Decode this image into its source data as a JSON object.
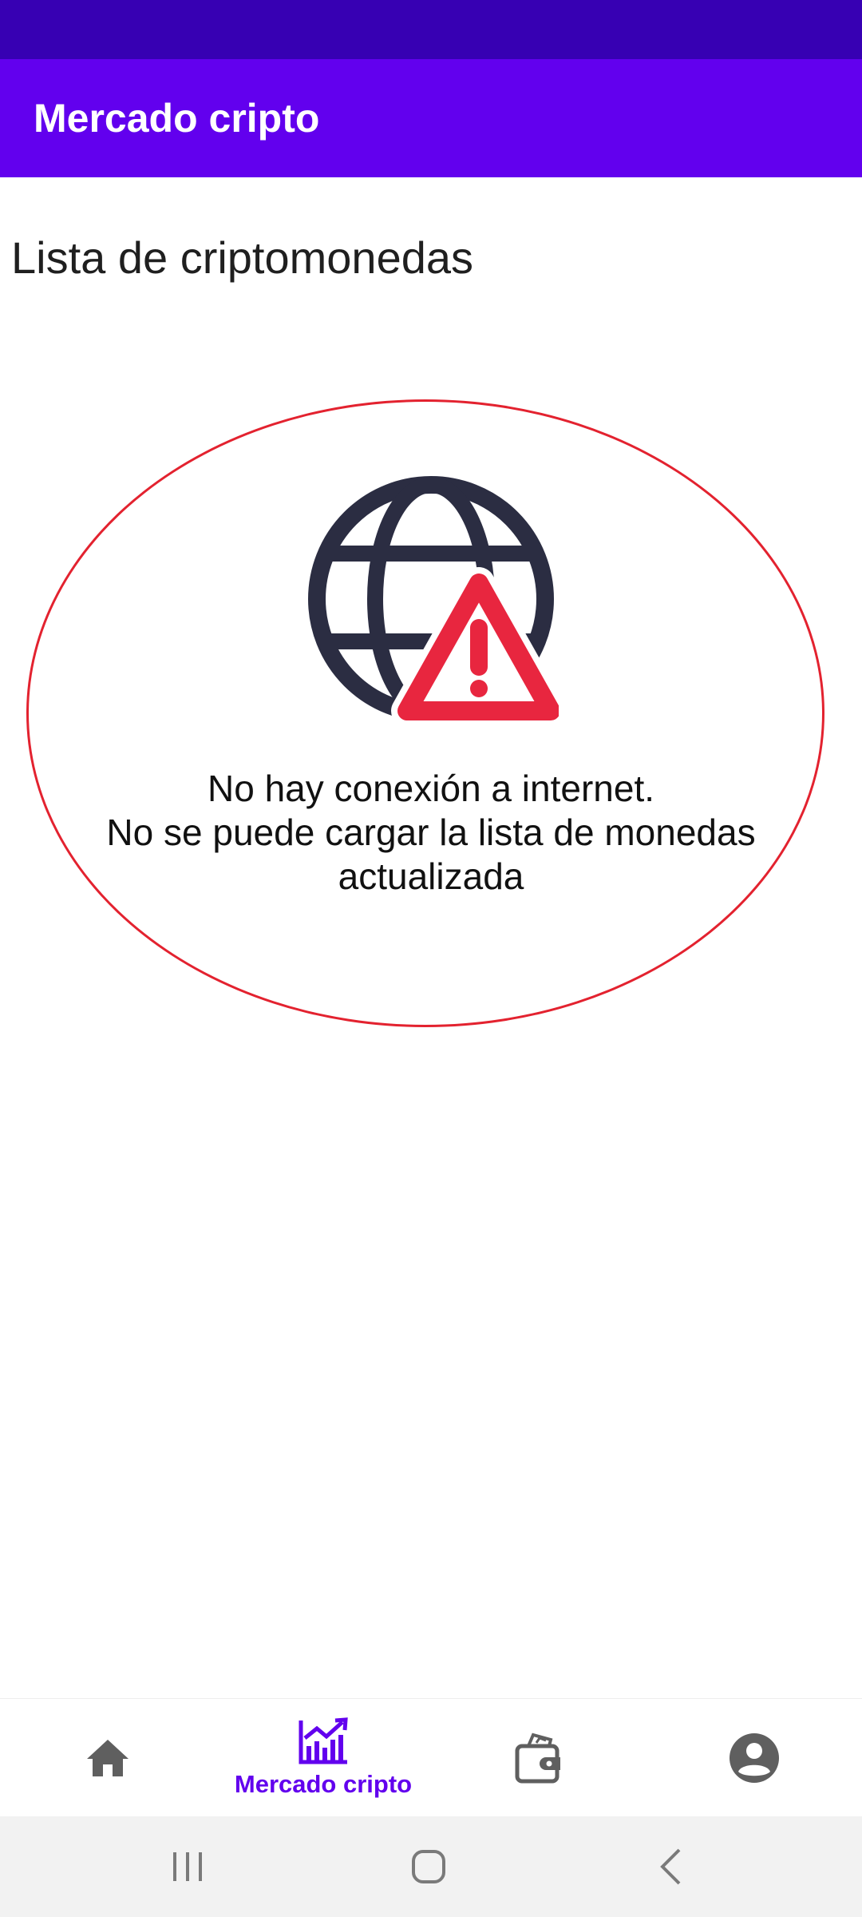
{
  "status_bar": {},
  "app_bar": {
    "title": "Mercado cripto"
  },
  "page": {
    "heading": "Lista de criptomonedas",
    "error": {
      "line1": "No hay conexión a internet.",
      "line2": "No se puede cargar la lista de monedas",
      "line3": "actualizada",
      "icon": "globe-warning-icon"
    }
  },
  "bottom_nav": {
    "items": [
      {
        "icon": "home-icon",
        "label": "",
        "active": false
      },
      {
        "icon": "market-chart-icon",
        "label": "Mercado cripto",
        "active": true
      },
      {
        "icon": "wallet-icon",
        "label": "",
        "active": false
      },
      {
        "icon": "account-icon",
        "label": "",
        "active": false
      }
    ]
  },
  "system_nav": {
    "buttons": [
      "recent-apps-icon",
      "home-button-icon",
      "back-icon"
    ]
  },
  "colors": {
    "primary": "#6200ee",
    "primary_dark": "#3700b3",
    "warning_red": "#e3222f",
    "globe": "#2b2d42"
  }
}
